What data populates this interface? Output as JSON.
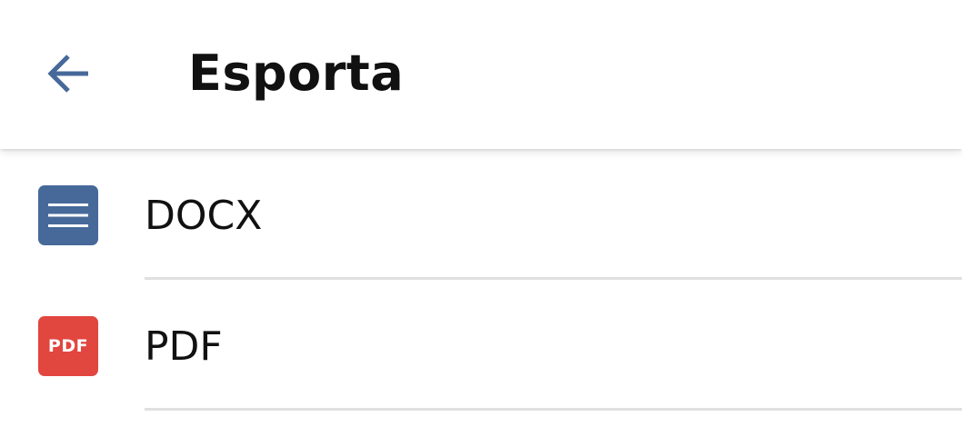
{
  "header": {
    "title": "Esporta",
    "back_icon": "arrow-back-icon",
    "back_color": "#46699a"
  },
  "export_options": [
    {
      "label": "DOCX",
      "icon": "docx-document-icon",
      "icon_color": "#46699a"
    },
    {
      "label": "PDF",
      "icon": "pdf-file-icon",
      "icon_color": "#e1463f",
      "icon_text": "PDF"
    }
  ]
}
